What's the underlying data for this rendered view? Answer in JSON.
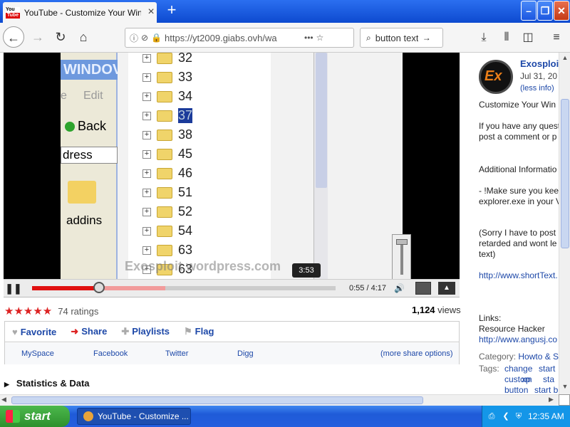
{
  "browser": {
    "tab_title": "YouTube - Customize Your Window",
    "tab_close": "×",
    "new_tab": "+",
    "url": "https://yt2009.giabs.ovh/wa",
    "search_text": "button text",
    "window_controls": {
      "minimize": "–",
      "maximize": "❐",
      "close": "✕"
    }
  },
  "video": {
    "window_title_strip": "WINDOV",
    "edit_menu": "Edit",
    "menu_letter": "e",
    "back_label": "Back",
    "address_label": "dress",
    "folder_label": "addins",
    "tree_items": [
      "32",
      "33",
      "34",
      "37",
      "38",
      "45",
      "46",
      "51",
      "52",
      "54",
      "63",
      "63"
    ],
    "selected_item": "37",
    "watermark": "Exosploit.wordpress.com"
  },
  "player": {
    "tooltip": "3:53",
    "timecode": "0:55 / 4:17",
    "played_fraction": 0.22,
    "loaded_fraction": 0.44
  },
  "ratings": {
    "stars": "★★★★★",
    "count_label": "74 ratings",
    "views_number": "1,124",
    "views_label": "views"
  },
  "actions": {
    "favorite": "Favorite",
    "share": "Share",
    "playlists": "Playlists",
    "flag": "Flag"
  },
  "share": {
    "myspace": "MySpace",
    "facebook": "Facebook",
    "twitter": "Twitter",
    "digg": "Digg",
    "more": "(more share options)"
  },
  "statistics_label": "Statistics & Data",
  "sidebar": {
    "channel_name": "Exosploit",
    "upload_date": "Jul 31, 20",
    "less_info": "(less info)",
    "lines": [
      {
        "text": "Customize Your Win",
        "link": false
      },
      {
        "text": "If you have any quest",
        "link": false
      },
      {
        "text": "post a comment or p",
        "link": false
      },
      {
        "text": "Additional Informatio",
        "link": false
      },
      {
        "text": "- !Make sure you kee",
        "link": false
      },
      {
        "text": "explorer.exe in your V",
        "link": false
      },
      {
        "text": "(Sorry I have to post",
        "link": false
      },
      {
        "text": "retarded and wont le",
        "link": false
      },
      {
        "text": "text)",
        "link": false
      },
      {
        "text": "http://www.shortText.",
        "link": true
      },
      {
        "text": "Links:",
        "link": false
      },
      {
        "text": "Resource Hacker",
        "link": false
      },
      {
        "text": "http://www.angusj.co",
        "link": true
      }
    ],
    "category_label": "Category:",
    "category_value": "Howto & S",
    "tags_label": "Tags:",
    "tags": [
      "change",
      "start",
      "custom",
      "xp",
      "sta",
      "button",
      "start b"
    ]
  },
  "taskbar": {
    "start_label": "start",
    "task_item": "YouTube - Customize ...",
    "clock": "12:35 AM"
  }
}
